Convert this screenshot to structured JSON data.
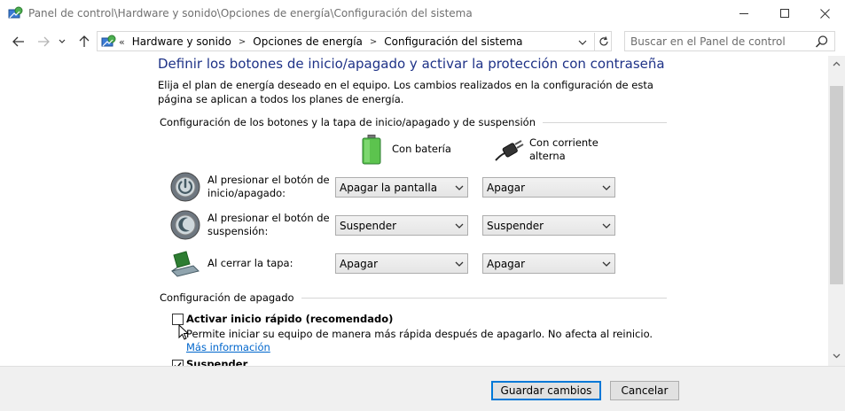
{
  "window": {
    "title": "Panel de control\\Hardware y sonido\\Opciones de energía\\Configuración del sistema"
  },
  "address": {
    "overflow": "«",
    "crumbs": [
      "Hardware y sonido",
      "Opciones de energía",
      "Configuración del sistema"
    ]
  },
  "search": {
    "placeholder": "Buscar en el Panel de control"
  },
  "page": {
    "heading": "Definir los botones de inicio/apagado y activar la protección con contraseña",
    "description": "Elija el plan de energía deseado en el equipo. Los cambios realizados en la configuración de esta página se aplican a todos los planes de energía."
  },
  "buttons_section": {
    "title": "Configuración de los botones y la tapa de inicio/apagado y de suspensión",
    "col_battery": "Con batería",
    "col_ac": "Con corriente alterna",
    "rows": [
      {
        "label": "Al presionar el botón de inicio/apagado:",
        "battery": "Apagar la pantalla",
        "ac": "Apagar"
      },
      {
        "label": "Al presionar el botón de suspensión:",
        "battery": "Suspender",
        "ac": "Suspender"
      },
      {
        "label": "Al cerrar la tapa:",
        "battery": "Apagar",
        "ac": "Apagar"
      }
    ]
  },
  "shutdown_section": {
    "title": "Configuración de apagado",
    "fast_startup_label": "Activar inicio rápido (recomendado)",
    "fast_startup_checked": false,
    "fast_startup_desc": "Permite iniciar su equipo de manera más rápida después de apagarlo. No afecta al reinicio.",
    "more_info_link": "Más información",
    "suspend_label": "Suspender",
    "suspend_checked": true
  },
  "footer": {
    "save": "Guardar cambios",
    "cancel": "Cancelar"
  },
  "colors": {
    "heading": "#1e3287",
    "link": "#0066cc",
    "accent": "#0078d7"
  }
}
